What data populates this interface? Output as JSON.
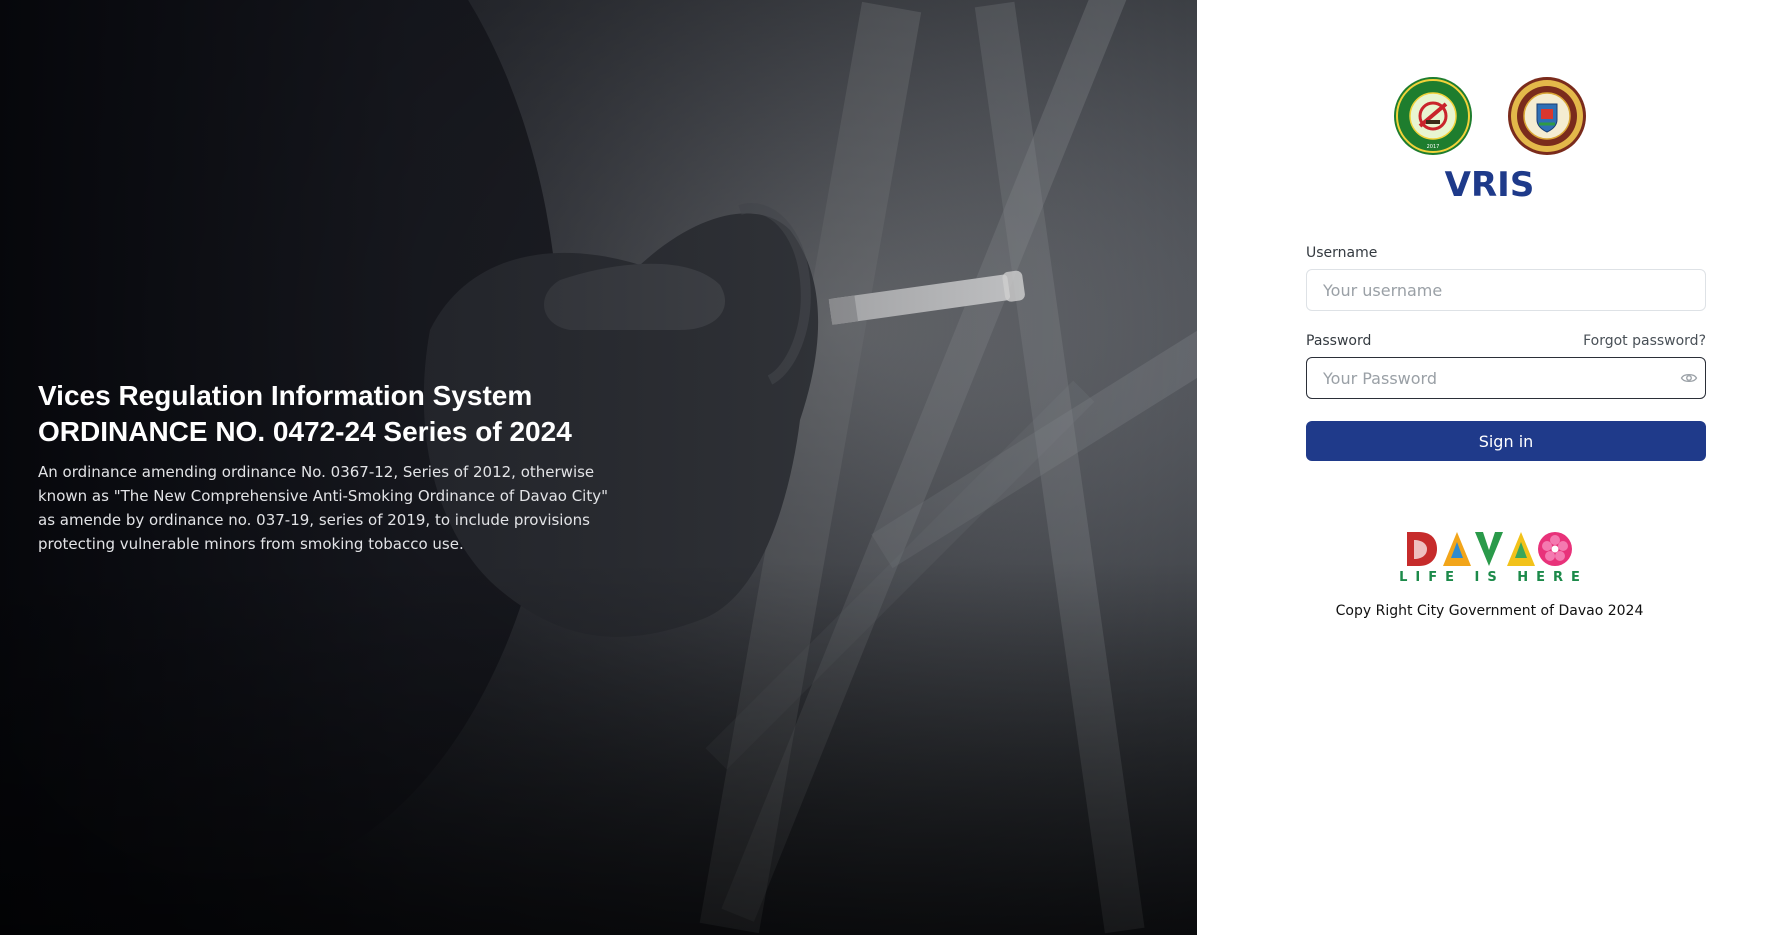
{
  "hero": {
    "title_line1": "Vices Regulation Information System",
    "title_line2": "ORDINANCE NO. 0472-24 Series of 2024",
    "description": "An ordinance amending ordinance No. 0367-12, Series of 2012, otherwise known as \"The New Comprehensive Anti-Smoking Ordinance of Davao City\" as amende by ordinance no. 037-19, series of 2019, to include provisions protecting vulnerable minors from smoking tobacco use."
  },
  "brand": {
    "app_name": "VRIS",
    "logo_left_ring_text": "VICES REGULATION UNIT · CITY OF DAVAO",
    "logo_left_year": "2017",
    "logo_right_ring_text": "LUNGSOD NG DABAW",
    "logo_right_bottom": "SAGISAG",
    "accent": "#1e3a8a"
  },
  "form": {
    "username_label": "Username",
    "username_placeholder": "Your username",
    "username_value": "",
    "password_label": "Password",
    "forgot_label": "Forgot password?",
    "password_placeholder": "Your Password",
    "password_value": "",
    "signin_label": "Sign in"
  },
  "footer": {
    "davao_logo_text": "DAVAO",
    "tagline": "LIFE IS HERE",
    "copyright": "Copy Right City Government of Davao 2024"
  },
  "icons": {
    "password_toggle": "eye-icon"
  }
}
